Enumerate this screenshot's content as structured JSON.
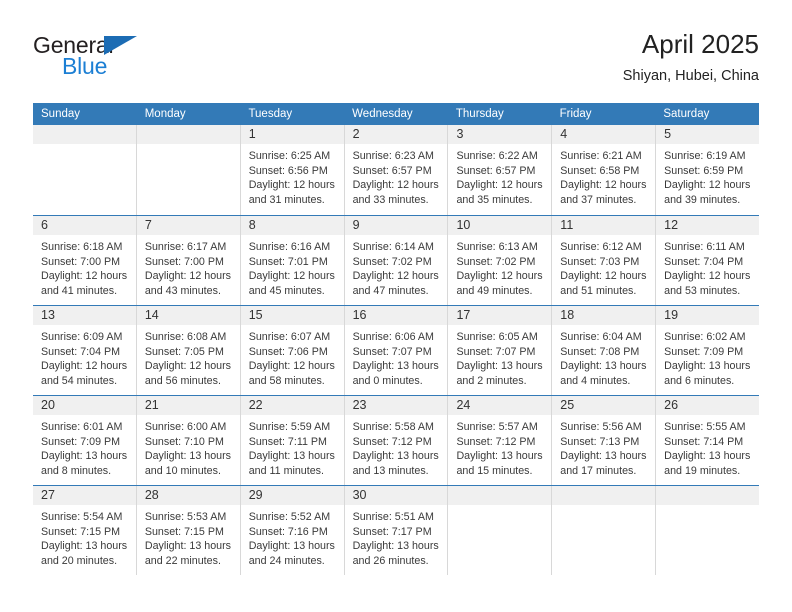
{
  "logo": {
    "word1": "General",
    "word2": "Blue",
    "triangle_color": "#1c6cb4",
    "blue_color": "#1c7fd4"
  },
  "header": {
    "title": "April 2025",
    "subtitle": "Shiyan, Hubei, China"
  },
  "theme": {
    "header_blue": "#337ab7",
    "band_gray": "#f0f0f0",
    "cell_border": "#d8d8d8"
  },
  "weekdays": [
    "Sunday",
    "Monday",
    "Tuesday",
    "Wednesday",
    "Thursday",
    "Friday",
    "Saturday"
  ],
  "weeks": [
    [
      {
        "day": "",
        "sunrise": "",
        "sunset": "",
        "daylight": "",
        "empty": true
      },
      {
        "day": "",
        "sunrise": "",
        "sunset": "",
        "daylight": "",
        "empty": true
      },
      {
        "day": "1",
        "sunrise": "Sunrise: 6:25 AM",
        "sunset": "Sunset: 6:56 PM",
        "daylight": "Daylight: 12 hours and 31 minutes."
      },
      {
        "day": "2",
        "sunrise": "Sunrise: 6:23 AM",
        "sunset": "Sunset: 6:57 PM",
        "daylight": "Daylight: 12 hours and 33 minutes."
      },
      {
        "day": "3",
        "sunrise": "Sunrise: 6:22 AM",
        "sunset": "Sunset: 6:57 PM",
        "daylight": "Daylight: 12 hours and 35 minutes."
      },
      {
        "day": "4",
        "sunrise": "Sunrise: 6:21 AM",
        "sunset": "Sunset: 6:58 PM",
        "daylight": "Daylight: 12 hours and 37 minutes."
      },
      {
        "day": "5",
        "sunrise": "Sunrise: 6:19 AM",
        "sunset": "Sunset: 6:59 PM",
        "daylight": "Daylight: 12 hours and 39 minutes."
      }
    ],
    [
      {
        "day": "6",
        "sunrise": "Sunrise: 6:18 AM",
        "sunset": "Sunset: 7:00 PM",
        "daylight": "Daylight: 12 hours and 41 minutes."
      },
      {
        "day": "7",
        "sunrise": "Sunrise: 6:17 AM",
        "sunset": "Sunset: 7:00 PM",
        "daylight": "Daylight: 12 hours and 43 minutes."
      },
      {
        "day": "8",
        "sunrise": "Sunrise: 6:16 AM",
        "sunset": "Sunset: 7:01 PM",
        "daylight": "Daylight: 12 hours and 45 minutes."
      },
      {
        "day": "9",
        "sunrise": "Sunrise: 6:14 AM",
        "sunset": "Sunset: 7:02 PM",
        "daylight": "Daylight: 12 hours and 47 minutes."
      },
      {
        "day": "10",
        "sunrise": "Sunrise: 6:13 AM",
        "sunset": "Sunset: 7:02 PM",
        "daylight": "Daylight: 12 hours and 49 minutes."
      },
      {
        "day": "11",
        "sunrise": "Sunrise: 6:12 AM",
        "sunset": "Sunset: 7:03 PM",
        "daylight": "Daylight: 12 hours and 51 minutes."
      },
      {
        "day": "12",
        "sunrise": "Sunrise: 6:11 AM",
        "sunset": "Sunset: 7:04 PM",
        "daylight": "Daylight: 12 hours and 53 minutes."
      }
    ],
    [
      {
        "day": "13",
        "sunrise": "Sunrise: 6:09 AM",
        "sunset": "Sunset: 7:04 PM",
        "daylight": "Daylight: 12 hours and 54 minutes."
      },
      {
        "day": "14",
        "sunrise": "Sunrise: 6:08 AM",
        "sunset": "Sunset: 7:05 PM",
        "daylight": "Daylight: 12 hours and 56 minutes."
      },
      {
        "day": "15",
        "sunrise": "Sunrise: 6:07 AM",
        "sunset": "Sunset: 7:06 PM",
        "daylight": "Daylight: 12 hours and 58 minutes."
      },
      {
        "day": "16",
        "sunrise": "Sunrise: 6:06 AM",
        "sunset": "Sunset: 7:07 PM",
        "daylight": "Daylight: 13 hours and 0 minutes."
      },
      {
        "day": "17",
        "sunrise": "Sunrise: 6:05 AM",
        "sunset": "Sunset: 7:07 PM",
        "daylight": "Daylight: 13 hours and 2 minutes."
      },
      {
        "day": "18",
        "sunrise": "Sunrise: 6:04 AM",
        "sunset": "Sunset: 7:08 PM",
        "daylight": "Daylight: 13 hours and 4 minutes."
      },
      {
        "day": "19",
        "sunrise": "Sunrise: 6:02 AM",
        "sunset": "Sunset: 7:09 PM",
        "daylight": "Daylight: 13 hours and 6 minutes."
      }
    ],
    [
      {
        "day": "20",
        "sunrise": "Sunrise: 6:01 AM",
        "sunset": "Sunset: 7:09 PM",
        "daylight": "Daylight: 13 hours and 8 minutes."
      },
      {
        "day": "21",
        "sunrise": "Sunrise: 6:00 AM",
        "sunset": "Sunset: 7:10 PM",
        "daylight": "Daylight: 13 hours and 10 minutes."
      },
      {
        "day": "22",
        "sunrise": "Sunrise: 5:59 AM",
        "sunset": "Sunset: 7:11 PM",
        "daylight": "Daylight: 13 hours and 11 minutes."
      },
      {
        "day": "23",
        "sunrise": "Sunrise: 5:58 AM",
        "sunset": "Sunset: 7:12 PM",
        "daylight": "Daylight: 13 hours and 13 minutes."
      },
      {
        "day": "24",
        "sunrise": "Sunrise: 5:57 AM",
        "sunset": "Sunset: 7:12 PM",
        "daylight": "Daylight: 13 hours and 15 minutes."
      },
      {
        "day": "25",
        "sunrise": "Sunrise: 5:56 AM",
        "sunset": "Sunset: 7:13 PM",
        "daylight": "Daylight: 13 hours and 17 minutes."
      },
      {
        "day": "26",
        "sunrise": "Sunrise: 5:55 AM",
        "sunset": "Sunset: 7:14 PM",
        "daylight": "Daylight: 13 hours and 19 minutes."
      }
    ],
    [
      {
        "day": "27",
        "sunrise": "Sunrise: 5:54 AM",
        "sunset": "Sunset: 7:15 PM",
        "daylight": "Daylight: 13 hours and 20 minutes."
      },
      {
        "day": "28",
        "sunrise": "Sunrise: 5:53 AM",
        "sunset": "Sunset: 7:15 PM",
        "daylight": "Daylight: 13 hours and 22 minutes."
      },
      {
        "day": "29",
        "sunrise": "Sunrise: 5:52 AM",
        "sunset": "Sunset: 7:16 PM",
        "daylight": "Daylight: 13 hours and 24 minutes."
      },
      {
        "day": "30",
        "sunrise": "Sunrise: 5:51 AM",
        "sunset": "Sunset: 7:17 PM",
        "daylight": "Daylight: 13 hours and 26 minutes."
      },
      {
        "day": "",
        "sunrise": "",
        "sunset": "",
        "daylight": "",
        "empty": true
      },
      {
        "day": "",
        "sunrise": "",
        "sunset": "",
        "daylight": "",
        "empty": true
      },
      {
        "day": "",
        "sunrise": "",
        "sunset": "",
        "daylight": "",
        "empty": true
      }
    ]
  ]
}
